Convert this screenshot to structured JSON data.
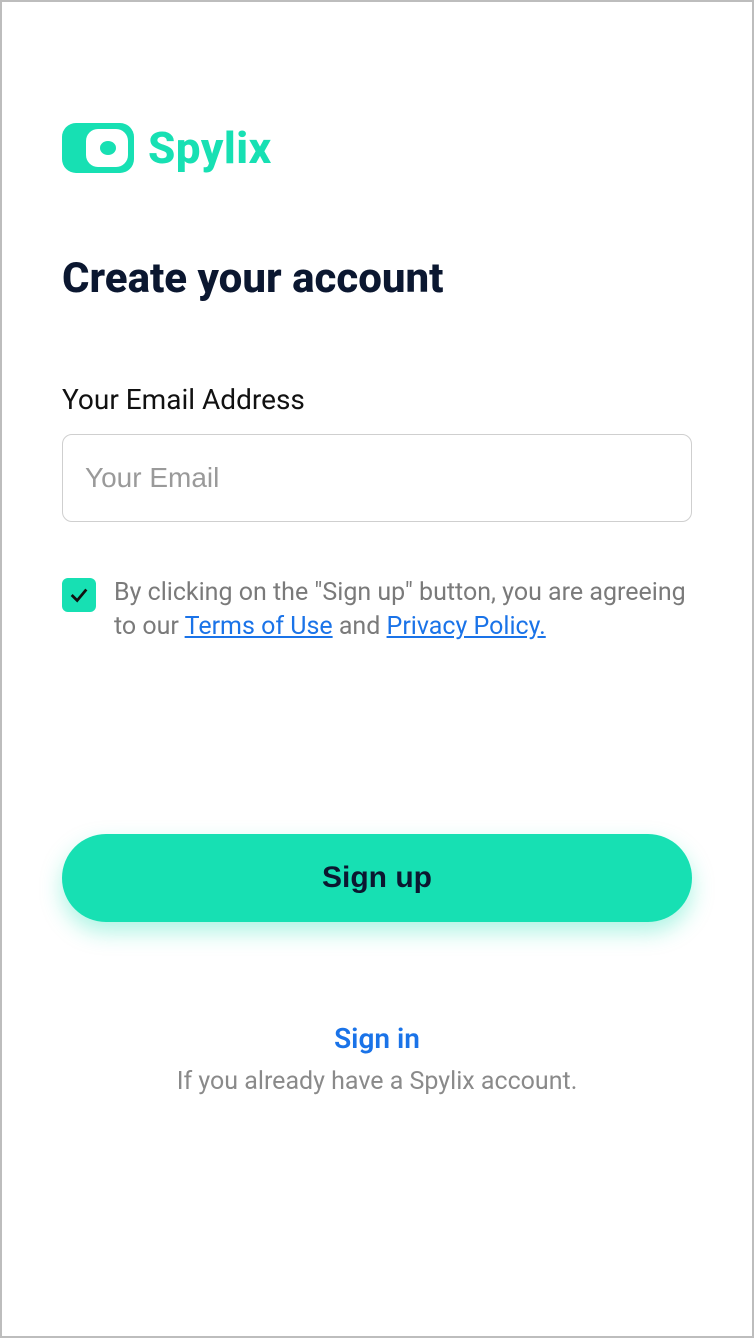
{
  "brand": {
    "name": "Spylix"
  },
  "header": {
    "title": "Create your account"
  },
  "form": {
    "email_label": "Your Email Address",
    "email_placeholder": "Your Email",
    "email_value": "",
    "agreement": {
      "checked": true,
      "pre": "By clicking on the \"Sign up\" button, you are agreeing to our ",
      "terms_label": "Terms of Use",
      "and": " and ",
      "privacy_label": "Privacy Policy."
    },
    "submit_label": "Sign up"
  },
  "footer": {
    "signin_link": "Sign in",
    "signin_sub": "If you already have a Spylix account."
  }
}
